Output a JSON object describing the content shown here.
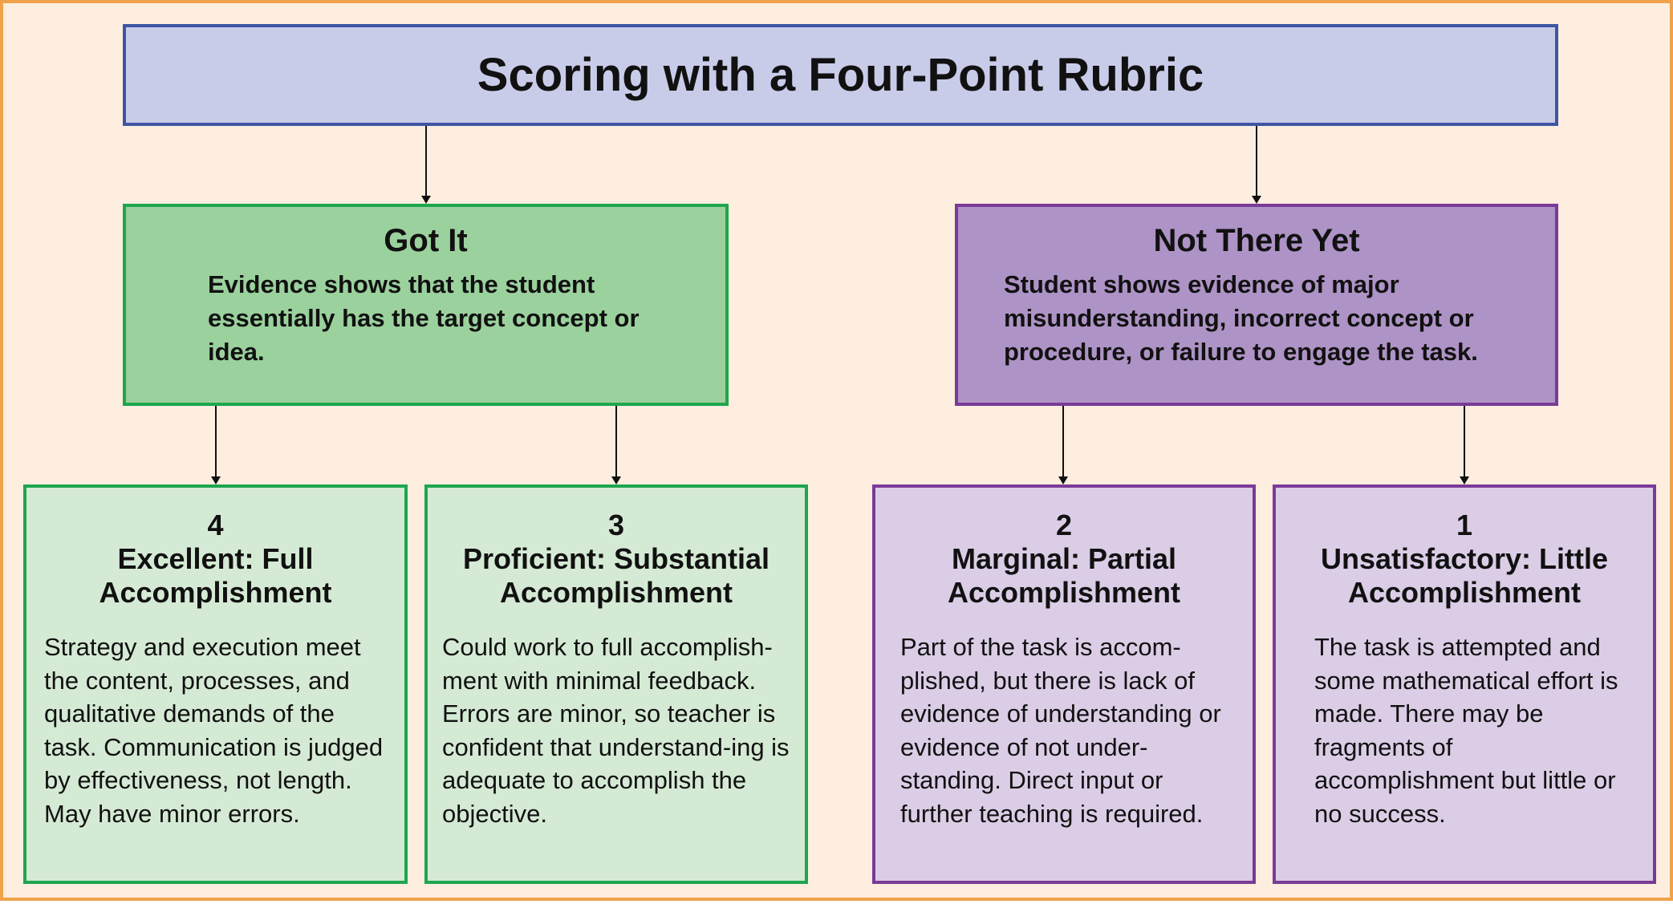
{
  "title": "Scoring with a Four-Point Rubric",
  "categories": [
    {
      "heading": "Got It",
      "description": "Evidence shows that the student essentially has the target concept or idea.",
      "color": "#1ea64f",
      "fill": "#9bd19d"
    },
    {
      "heading": "Not There Yet",
      "description": "Student shows evidence of major misunderstanding, incorrect concept or procedure, or failure to engage the task.",
      "color": "#7a3b97",
      "fill": "#ae93c6"
    }
  ],
  "levels": [
    {
      "score": "4",
      "label": "Excellent: Full\nAccomplishment",
      "description": "Strategy and execution meet the content, processes, and qualitative demands of the task. Communication is judged by effectiveness, not length. May have minor errors."
    },
    {
      "score": "3",
      "label": "Proficient: Substantial\nAccomplishment",
      "description": "Could work to full accomplish-ment with minimal feedback. Errors are minor, so teacher is confident that understand-ing is adequate to accomplish the objective."
    },
    {
      "score": "2",
      "label": "Marginal: Partial\nAccomplishment",
      "description": "Part of the task is accom-plished, but there is lack of evidence of understanding or evidence of not under-standing. Direct input or further teaching is required."
    },
    {
      "score": "1",
      "label": "Unsatisfactory: Little\nAccomplishment",
      "description": "The task is attempted and some mathematical effort is made. There may be fragments of accomplishment but little or no success."
    }
  ],
  "colors": {
    "border_frame": "#f0a24a",
    "background": "#fdeedf",
    "title_fill": "#c9cce9",
    "title_border": "#3f55a3",
    "green_leaf_fill": "#d5ead4",
    "purple_leaf_fill": "#dbcde6"
  }
}
